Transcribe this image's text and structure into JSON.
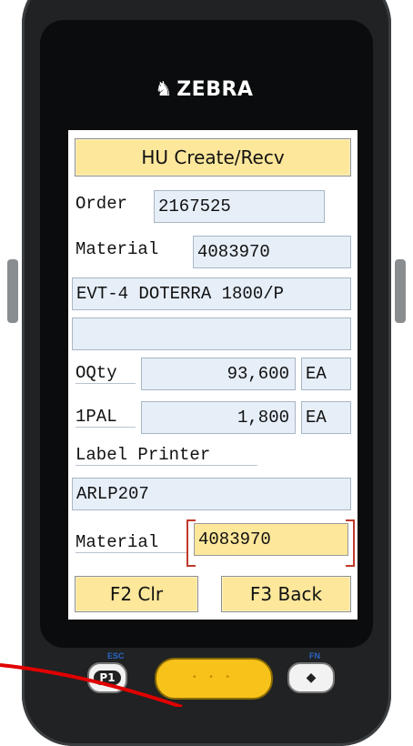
{
  "device": {
    "brand": "ZEBRA",
    "keys": {
      "p1": "P1",
      "esc": "ESC",
      "fn": "FN",
      "scan_dots": "• • •",
      "diamond": "◆"
    }
  },
  "screen": {
    "title_button": "HU Create/Recv",
    "order": {
      "label": "Order",
      "value": "2167525"
    },
    "material_top": {
      "label": "Material",
      "value": "4083970"
    },
    "description": "EVT-4 DOTERRA 1800/P",
    "blank_field": "",
    "oqty": {
      "label": "OQty",
      "value": "93,600",
      "unit": "EA"
    },
    "pal": {
      "label": "1PAL",
      "value": "1,800",
      "unit": "EA"
    },
    "label_printer": {
      "label": "Label Printer",
      "value": "ARLP207"
    },
    "material_scan": {
      "label": "Material",
      "value": "4083970"
    },
    "f2_button": "F2 Clr",
    "f3_button": "F3 Back"
  },
  "colors": {
    "button_yellow": "#fde79b",
    "field_blue": "#e6eef8",
    "focus_red": "#c0392b",
    "annotation_red": "#e10000"
  }
}
